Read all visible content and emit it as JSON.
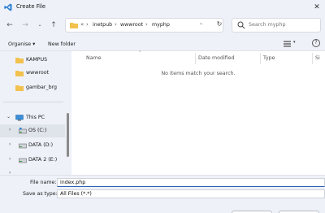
{
  "window": {
    "title": "Create File"
  },
  "nav": {
    "path": [
      "inetpub",
      "wwwroot",
      "myphp"
    ],
    "overflow": "«",
    "search_placeholder": "Search myphp"
  },
  "toolbar": {
    "organise": "Organise ▾",
    "new_folder": "New folder"
  },
  "sidebar": {
    "items": [
      {
        "label": "KAMPUS",
        "icon": "folder-icon"
      },
      {
        "label": "wwwroot",
        "icon": "folder-icon"
      },
      {
        "label": "gambar_brg",
        "icon": "folder-icon"
      },
      {
        "label": "This PC",
        "icon": "pc-icon"
      },
      {
        "label": "OS (C:)",
        "icon": "os-drive-icon"
      },
      {
        "label": "DATA (D:)",
        "icon": "drive-icon"
      },
      {
        "label": "DATA 2 (E:)",
        "icon": "drive-icon"
      }
    ]
  },
  "columns": [
    "Name",
    "Date modified",
    "Type",
    "Si"
  ],
  "empty_message": "No items match your search.",
  "form": {
    "filename_label": "File name:",
    "filename_value": "index.php",
    "savetype_label": "Save as type:",
    "savetype_value": "All Files (*.*)"
  },
  "colors": {
    "accent": "#2b5fb5",
    "folder": "#f2c14e",
    "vscode": "#2a7fd4"
  }
}
